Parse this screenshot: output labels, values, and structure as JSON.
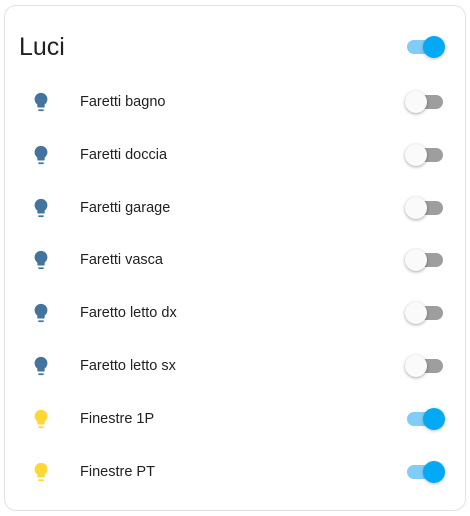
{
  "card": {
    "title": "Luci",
    "master_toggle_on": true
  },
  "colors": {
    "bulb_off": "#44739e",
    "bulb_on": "#fdd835",
    "toggle_on": "#03a9f4",
    "toggle_off": "#9e9e9e"
  },
  "entities": [
    {
      "name": "Faretti bagno",
      "on": false,
      "icon": "lightbulb-icon"
    },
    {
      "name": "Faretti doccia",
      "on": false,
      "icon": "lightbulb-icon"
    },
    {
      "name": "Faretti garage",
      "on": false,
      "icon": "lightbulb-icon"
    },
    {
      "name": "Faretti vasca",
      "on": false,
      "icon": "lightbulb-icon"
    },
    {
      "name": "Faretto letto dx",
      "on": false,
      "icon": "lightbulb-icon"
    },
    {
      "name": "Faretto letto sx",
      "on": false,
      "icon": "lightbulb-icon"
    },
    {
      "name": "Finestre 1P",
      "on": true,
      "icon": "lightbulb-icon"
    },
    {
      "name": "Finestre PT",
      "on": true,
      "icon": "lightbulb-icon"
    }
  ]
}
